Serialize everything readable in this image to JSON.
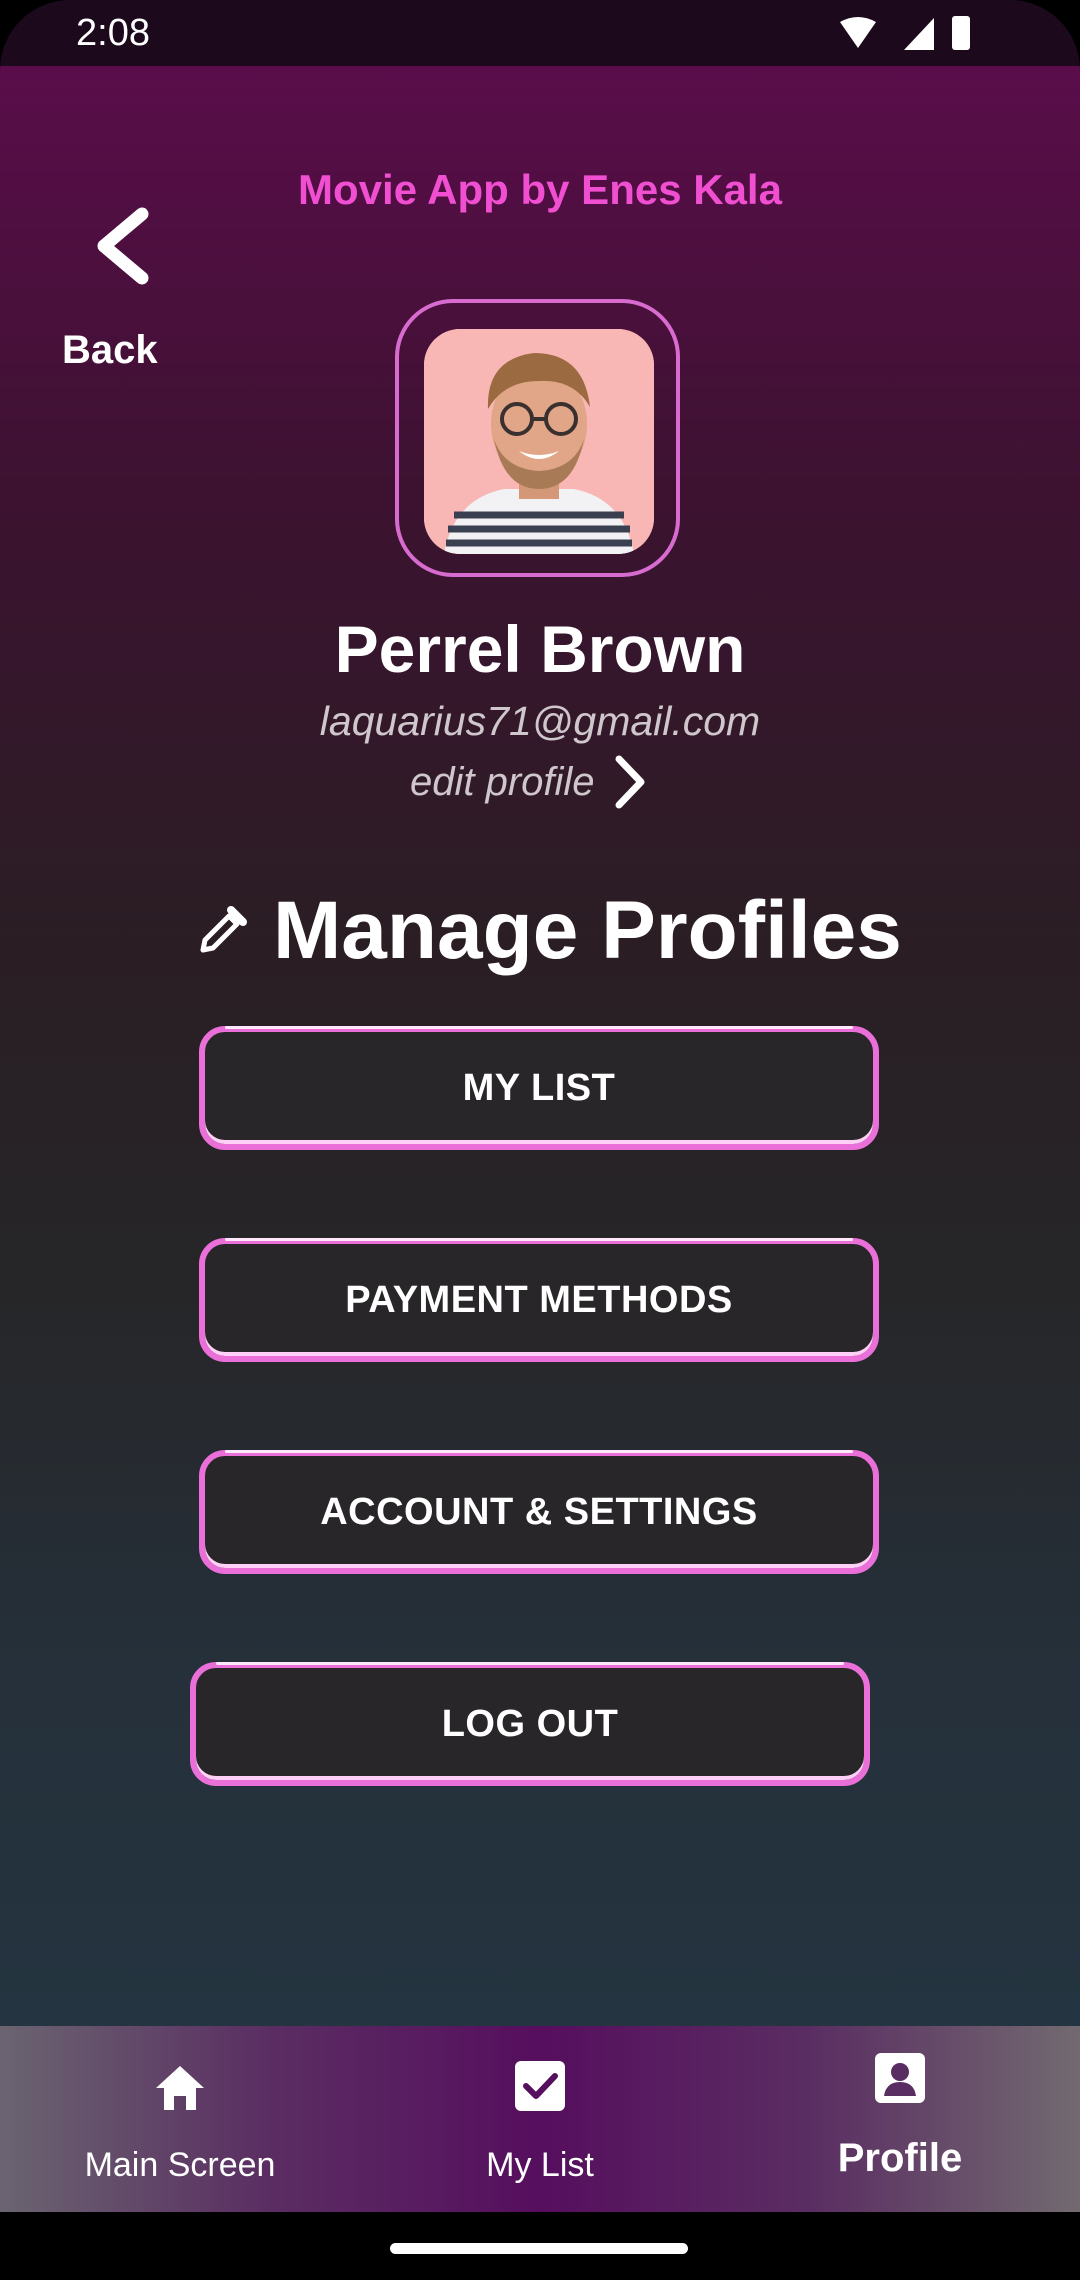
{
  "status_bar": {
    "time": "2:08"
  },
  "header": {
    "app_title": "Movie App by Enes Kala",
    "back_label": "Back"
  },
  "profile": {
    "name": "Perrel Brown",
    "email": "laquarius71@gmail.com",
    "edit_label": "edit profile"
  },
  "manage": {
    "title": "Manage Profiles"
  },
  "menu": {
    "my_list": "MY LIST",
    "payment_methods": "PAYMENT METHODS",
    "account_settings": "ACCOUNT & SETTINGS",
    "log_out": "LOG OUT"
  },
  "bottom_nav": {
    "items": [
      {
        "label": "Main Screen",
        "icon": "home-icon"
      },
      {
        "label": "My List",
        "icon": "checkbox-icon"
      },
      {
        "label": "Profile",
        "icon": "account-box-icon",
        "active": true
      }
    ]
  },
  "colors": {
    "accent": "#f04fd2",
    "button_border": "#ea6fd9",
    "button_fill": "#282628"
  }
}
